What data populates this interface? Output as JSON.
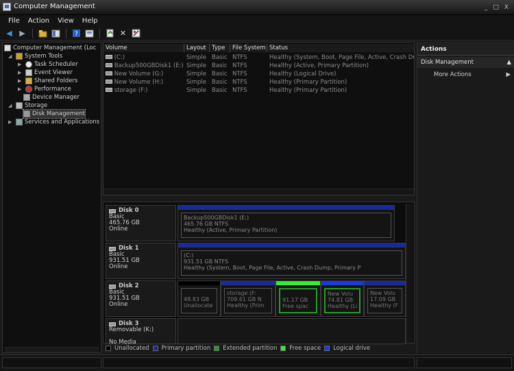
{
  "window": {
    "title": "Computer Management",
    "controls": [
      "_",
      "□",
      "X"
    ]
  },
  "menu": [
    "File",
    "Action",
    "View",
    "Help"
  ],
  "toolbar": {
    "buttons": [
      "back-icon",
      "forward-icon",
      "up-icon",
      "show-hide-tree-icon",
      "help-icon",
      "properties-icon",
      "refresh-icon",
      "delete-icon",
      "settings-icon"
    ]
  },
  "tree": {
    "root": "Computer Management (Loc",
    "system_tools": "System Tools",
    "task_scheduler": "Task Scheduler",
    "event_viewer": "Event Viewer",
    "shared_folders": "Shared Folders",
    "performance": "Performance",
    "device_manager": "Device Manager",
    "storage": "Storage",
    "disk_management": "Disk Management",
    "services": "Services and Applications"
  },
  "volumes": {
    "headers": [
      "Volume",
      "Layout",
      "Type",
      "File System",
      "Status"
    ],
    "rows": [
      [
        "(C:)",
        "Simple",
        "Basic",
        "NTFS",
        "Healthy (System, Boot, Page File, Active, Crash Dum"
      ],
      [
        "Backup500GBDisk1 (E:)",
        "Simple",
        "Basic",
        "NTFS",
        "Healthy (Active, Primary Partition)"
      ],
      [
        "New Volume (G:)",
        "Simple",
        "Basic",
        "NTFS",
        "Healthy (Logical Drive)"
      ],
      [
        "New Volume (H:)",
        "Simple",
        "Basic",
        "NTFS",
        "Healthy (Primary Partition)"
      ],
      [
        "storage (F:)",
        "Simple",
        "Basic",
        "NTFS",
        "Healthy (Primary Partition)"
      ]
    ]
  },
  "disks": {
    "disk0": {
      "name": "Disk 0",
      "type": "Basic",
      "size": "465.76 GB",
      "state": "Online",
      "p1_name": "Backup500GBDisk1  (E:)",
      "p1_size": "465.76 GB NTFS",
      "p1_status": "Healthy (Active, Primary Partition)"
    },
    "disk1": {
      "name": "Disk 1",
      "type": "Basic",
      "size": "931.51 GB",
      "state": "Online",
      "p1_name": "(C:)",
      "p1_size": "931.51 GB NTFS",
      "p1_status": "Healthy (System, Boot, Page File, Active, Crash Dump, Primary P"
    },
    "disk2": {
      "name": "Disk 2",
      "type": "Basic",
      "size": "931.51 GB",
      "state": "Online",
      "p1_size": "48.83 GB",
      "p1_status": "Unallocate",
      "p2_name": "storage  (F:",
      "p2_size": "709.61 GB N",
      "p2_status": "Healthy (Prim",
      "p3_size": "91.17 GB",
      "p3_status": "Free spac",
      "p4_name": "New Volu",
      "p4_size": "74.81 GB",
      "p4_status": "Healthy (Li",
      "p5_name": "New Volu",
      "p5_size": "17.09 GB",
      "p5_status": "Healthy (F"
    },
    "disk3": {
      "name": "Disk 3",
      "type": "Removable (K:)",
      "state": "No Media"
    }
  },
  "legend": {
    "unallocated": "Unallocated",
    "primary": "Primary partition",
    "extended": "Extended partition",
    "free": "Free space",
    "logical": "Logical drive"
  },
  "colors": {
    "unallocated": "#000000",
    "primary": "#1a2a9a",
    "extended": "#2a9a2a",
    "free": "#33ee33",
    "logical": "#1a3ae0"
  },
  "actions": {
    "title": "Actions",
    "section": "Disk Management",
    "more": "More Actions"
  }
}
